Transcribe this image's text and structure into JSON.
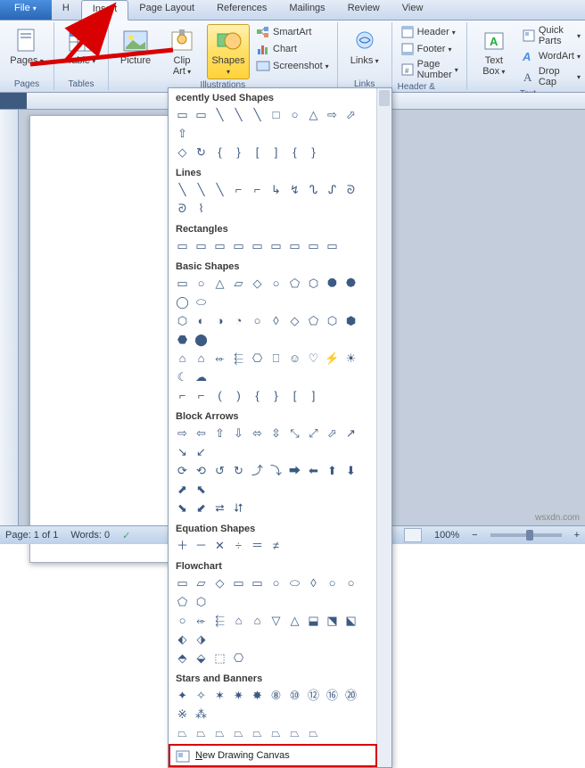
{
  "tabs": {
    "file": "File",
    "home_prefix": "H",
    "insert": "Insert",
    "page_layout": "Page Layout",
    "references": "References",
    "mailings": "Mailings",
    "review": "Review",
    "view": "View"
  },
  "ribbon": {
    "pages": {
      "label": "Pages",
      "btn": "Pages"
    },
    "tables": {
      "label": "Tables",
      "btn": "Table"
    },
    "illustrations": {
      "label": "Illustrations",
      "picture": "Picture",
      "clipart": "Clip\nArt",
      "shapes": "Shapes",
      "smartart": "SmartArt",
      "chart": "Chart",
      "screenshot": "Screenshot"
    },
    "links": {
      "label": "Links",
      "btn": "Links"
    },
    "headerfooter": {
      "label": "Header & Footer",
      "header": "Header",
      "footer": "Footer",
      "pagenum": "Page Number"
    },
    "text": {
      "label": "Text",
      "textbox": "Text\nBox",
      "quickparts": "Quick Parts",
      "wordart": "WordArt",
      "dropcap": "Drop Cap"
    }
  },
  "shapes_menu": {
    "recent": {
      "title": "ecently Used Shapes",
      "rows": [
        [
          "▭",
          "▭",
          "╲",
          "╲",
          "╲",
          "□",
          "○",
          "△",
          "⇨",
          "⬀",
          "⇧"
        ],
        [
          "◇",
          "↻",
          "{",
          "}",
          "[",
          "]",
          "{",
          "}"
        ]
      ]
    },
    "lines": {
      "title": "Lines",
      "rows": [
        [
          "╲",
          "╲",
          "╲",
          "⌐",
          "⌐",
          "↳",
          "↯",
          "ᔐ",
          "ᔑ",
          "ᘐ",
          "ᘑ",
          "⌇"
        ]
      ]
    },
    "rectangles": {
      "title": "Rectangles",
      "rows": [
        [
          "▭",
          "▭",
          "▭",
          "▭",
          "▭",
          "▭",
          "▭",
          "▭",
          "▭"
        ]
      ]
    },
    "basic": {
      "title": "Basic Shapes",
      "rows": [
        [
          "▭",
          "○",
          "△",
          "▱",
          "◇",
          "○",
          "⬠",
          "⬡",
          "⯃",
          "⯄",
          "◯",
          "⬭"
        ],
        [
          "⬡",
          "◐",
          "◑",
          "◔",
          "○",
          "◊",
          "◇",
          "⬠",
          "⬡",
          "⬢",
          "⬣",
          "⬤"
        ],
        [
          "⌂",
          "⌂",
          "⬰",
          "⬱",
          "⎔",
          "⎕",
          "☺",
          "♡",
          "⚡",
          "☀",
          "☾",
          "☁"
        ],
        [
          "⌐",
          "⌐",
          "(",
          ")",
          "{",
          "}",
          "[",
          "]"
        ]
      ]
    },
    "arrows": {
      "title": "Block Arrows",
      "rows": [
        [
          "⇨",
          "⇦",
          "⇧",
          "⇩",
          "⬄",
          "⇳",
          "⤡",
          "⤢",
          "⬀",
          "↗",
          "↘",
          "↙"
        ],
        [
          "⟳",
          "⟲",
          "↺",
          "↻",
          "⤴",
          "⤵",
          "⮕",
          "⬅",
          "⬆",
          "⬇",
          "⬈",
          "⬉"
        ],
        [
          "⬊",
          "⬋",
          "⮂",
          "⮃"
        ]
      ]
    },
    "equation": {
      "title": "Equation Shapes",
      "rows": [
        [
          "＋",
          "－",
          "✕",
          "÷",
          "＝",
          "≠"
        ]
      ]
    },
    "flowchart": {
      "title": "Flowchart",
      "rows": [
        [
          "▭",
          "▱",
          "◇",
          "▭",
          "▭",
          "○",
          "⬭",
          "◊",
          "○",
          "○",
          "⬠",
          "⬡"
        ],
        [
          "○",
          "⬰",
          "⬱",
          "⌂",
          "⌂",
          "▽",
          "△",
          "⬓",
          "⬔",
          "⬕",
          "⬖",
          "⬗"
        ],
        [
          "⬘",
          "⬙",
          "⬚",
          "⎔"
        ]
      ]
    },
    "stars": {
      "title": "Stars and Banners",
      "rows": [
        [
          "✦",
          "✧",
          "✶",
          "✷",
          "✸",
          "⑧",
          "⑩",
          "⑫",
          "⑯",
          "⑳",
          "※",
          "⁂"
        ],
        [
          "⏢",
          "⏢",
          "⏢",
          "⏢",
          "⏢",
          "⏢",
          "⏢",
          "⏢"
        ]
      ]
    },
    "new_canvas": "ew Drawing Canvas",
    "new_canvas_u": "N"
  },
  "status": {
    "page": "Page: 1 of 1",
    "words": "Words: 0",
    "lang_icon": "✓",
    "zoom": "100%",
    "minus": "−",
    "plus": "+"
  },
  "watermark": "wsxdn.com",
  "colors": {
    "accent_blue": "#2a66b6",
    "highlight": "#ffd23a",
    "red": "#d80000"
  }
}
